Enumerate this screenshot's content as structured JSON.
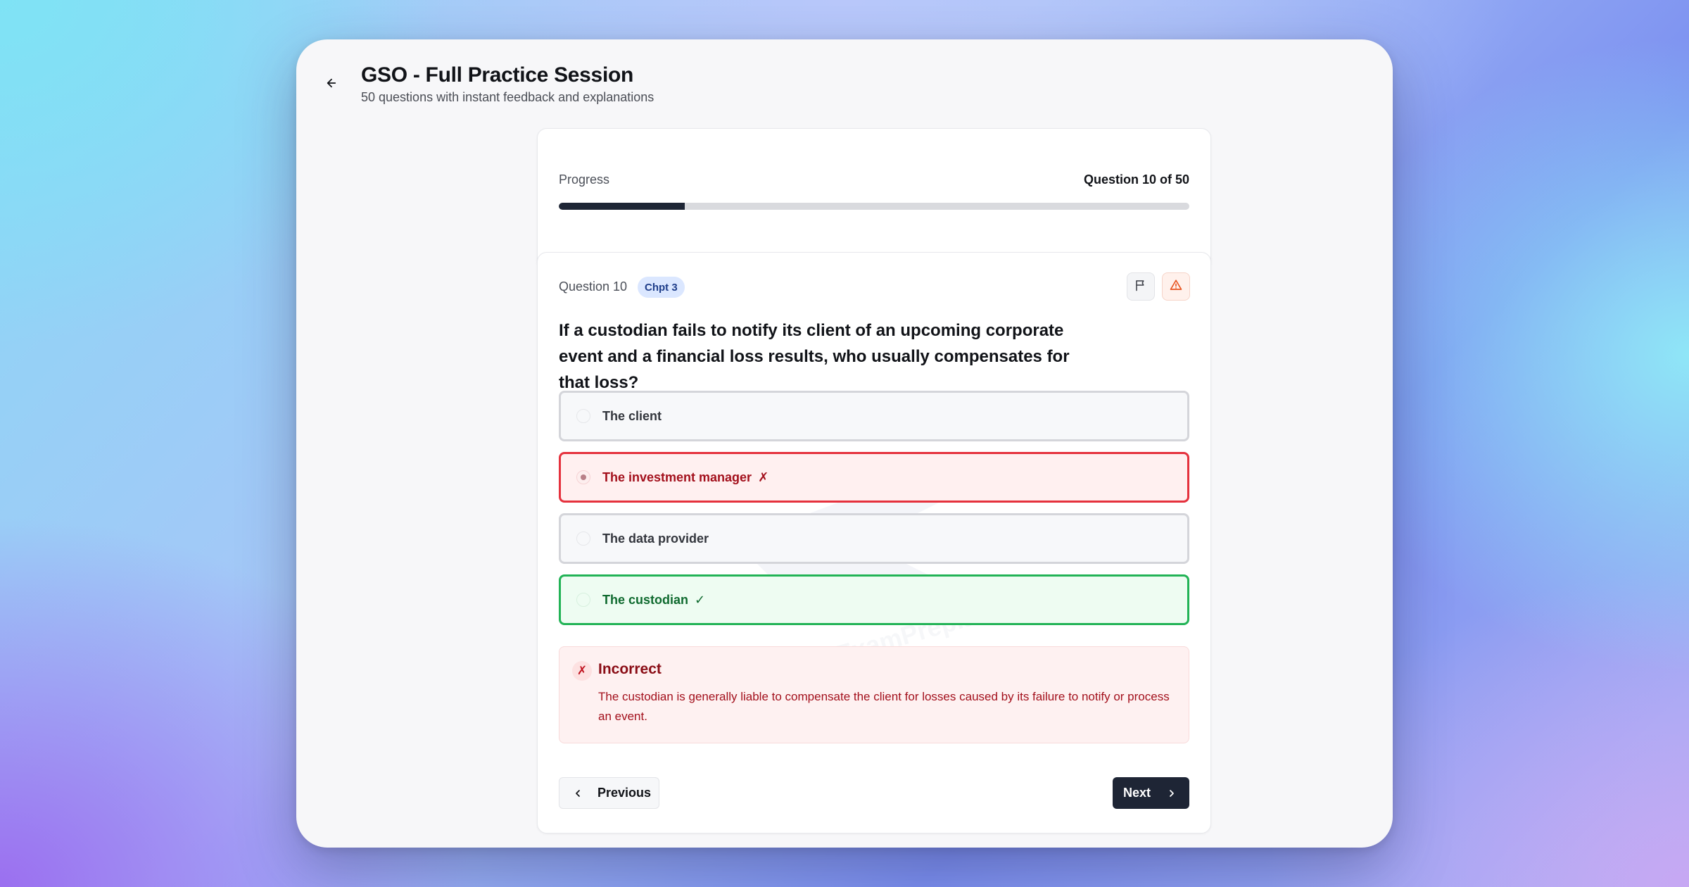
{
  "header": {
    "title": "GSO - Full Practice Session",
    "subtitle": "50 questions with instant feedback and explanations"
  },
  "progress": {
    "label": "Progress",
    "count_text": "Question 10 of 50",
    "current": 10,
    "total": 50,
    "fill_fraction": 0.2
  },
  "question": {
    "number_label": "Question 10",
    "chapter_badge": "Chpt 3",
    "text": "If a custodian fails to notify its client of an upcoming corporate event and a financial loss results, who usually compensates for that loss?",
    "options": [
      {
        "label": "The client",
        "state": "neutral",
        "mark": ""
      },
      {
        "label": "The investment manager",
        "state": "selected-incorrect",
        "mark": "✗"
      },
      {
        "label": "The data provider",
        "state": "neutral",
        "mark": ""
      },
      {
        "label": "The custodian",
        "state": "correct",
        "mark": "✓"
      }
    ]
  },
  "feedback": {
    "icon": "✗",
    "title": "Incorrect",
    "text": "The custodian is generally liable to compensate the client for losses caused by its failure to notify or process an event."
  },
  "navigation": {
    "previous_label": "Previous",
    "next_label": "Next"
  },
  "watermark": "ExamPrep.ae",
  "icons": {
    "back": "arrow-left-icon",
    "flag": "flag-icon",
    "report": "alert-triangle-icon",
    "prev": "chevron-left-icon",
    "next": "chevron-right-icon"
  },
  "colors": {
    "primary_dark": "#1e2535",
    "incorrect": "#e5313d",
    "correct": "#22b356",
    "badge_bg": "#dbe7ff"
  }
}
